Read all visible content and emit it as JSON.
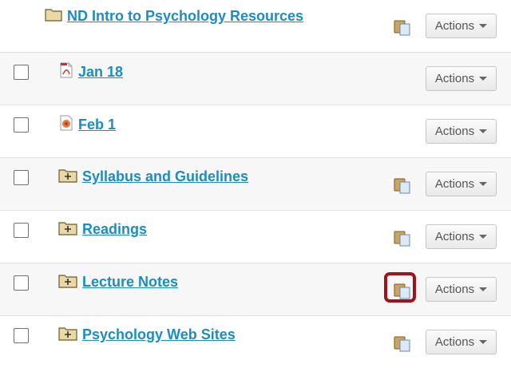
{
  "items": [
    {
      "title": "ND Intro to Psychology Resources",
      "type": "folder-root",
      "has_checkbox": false,
      "has_copy": true,
      "copy_highlighted": false
    },
    {
      "title": "Jan 18",
      "type": "pdf",
      "has_checkbox": true,
      "has_copy": false,
      "copy_highlighted": false
    },
    {
      "title": "Feb 1",
      "type": "image-file",
      "has_checkbox": true,
      "has_copy": false,
      "copy_highlighted": false
    },
    {
      "title": "Syllabus and Guidelines",
      "type": "folder-collapsed",
      "has_checkbox": true,
      "has_copy": true,
      "copy_highlighted": false
    },
    {
      "title": "Readings",
      "type": "folder-collapsed",
      "has_checkbox": true,
      "has_copy": true,
      "copy_highlighted": false
    },
    {
      "title": "Lecture Notes",
      "type": "folder-collapsed",
      "has_checkbox": true,
      "has_copy": true,
      "copy_highlighted": true
    },
    {
      "title": "Psychology Web Sites",
      "type": "folder-collapsed",
      "has_checkbox": true,
      "has_copy": true,
      "copy_highlighted": false
    }
  ],
  "actions_label": "Actions",
  "icons": {
    "copy": "clipboard-copy-icon",
    "folder": "folder-icon",
    "folder_expand": "folder-plus-icon",
    "pdf": "pdf-file-icon",
    "image": "image-file-icon",
    "dropdown": "chevron-down-icon"
  },
  "colors": {
    "link": "#1a8dc4",
    "highlight": "#a3121b",
    "folder": "#e9d9a6"
  }
}
